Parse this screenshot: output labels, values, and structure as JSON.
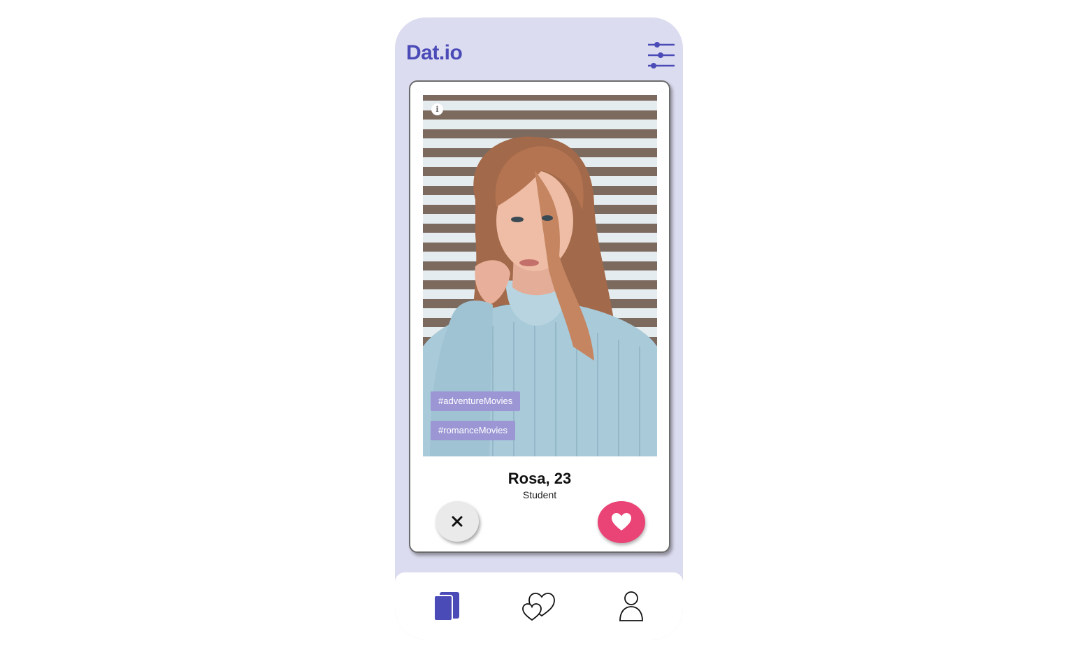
{
  "app": {
    "title": "Dat.io",
    "accent_color": "#4b4bb8",
    "background_color": "#dcdcf0"
  },
  "header": {
    "filter_icon": "sliders-icon"
  },
  "profile_card": {
    "info_icon": "info-icon",
    "info_glyph": "i",
    "tags": [
      "#adventureMovies",
      "#romanceMovies"
    ],
    "tag_color": "#9c97d4",
    "name_age": "Rosa, 23",
    "occupation": "Student"
  },
  "actions": {
    "dislike_icon": "close-icon",
    "dislike_glyph": "✕",
    "like_icon": "heart-icon",
    "like_color": "#ea4376"
  },
  "bottom_nav": {
    "items": [
      {
        "icon": "cards-icon",
        "active": true
      },
      {
        "icon": "hearts-icon",
        "active": false
      },
      {
        "icon": "user-icon",
        "active": false
      }
    ]
  }
}
